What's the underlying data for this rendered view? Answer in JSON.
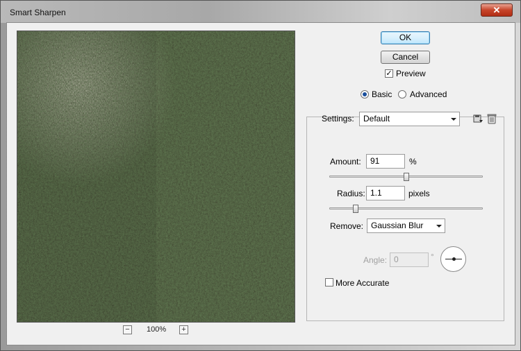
{
  "window": {
    "title": "Smart Sharpen",
    "close_glyph": "✕"
  },
  "preview": {
    "zoom_level": "100%",
    "zoom_out_glyph": "−",
    "zoom_in_glyph": "+"
  },
  "buttons": {
    "ok": "OK",
    "cancel": "Cancel"
  },
  "preview_toggle": {
    "label": "Preview",
    "checked": true,
    "glyph": "✓"
  },
  "mode": {
    "options": [
      "Basic",
      "Advanced"
    ],
    "selected": "Basic"
  },
  "settings": {
    "label": "Settings:",
    "value": "Default",
    "save_icon": "save-settings-icon",
    "delete_icon": "delete-settings-icon"
  },
  "amount": {
    "label": "Amount:",
    "value": "91",
    "unit": "%",
    "slider_fraction": 0.5
  },
  "radius": {
    "label": "Radius:",
    "value": "1.1",
    "unit": "pixels",
    "slider_fraction": 0.17
  },
  "remove": {
    "label": "Remove:",
    "value": "Gaussian Blur"
  },
  "angle": {
    "label": "Angle:",
    "value": "0",
    "unit": "°",
    "enabled": false
  },
  "more_accurate": {
    "label": "More Accurate",
    "checked": false
  },
  "colors": {
    "accent": "#3c7fb1",
    "grass_dark": "#1f2a15",
    "grass_dry": "#8f8870",
    "soil": "#2b2a1e"
  }
}
